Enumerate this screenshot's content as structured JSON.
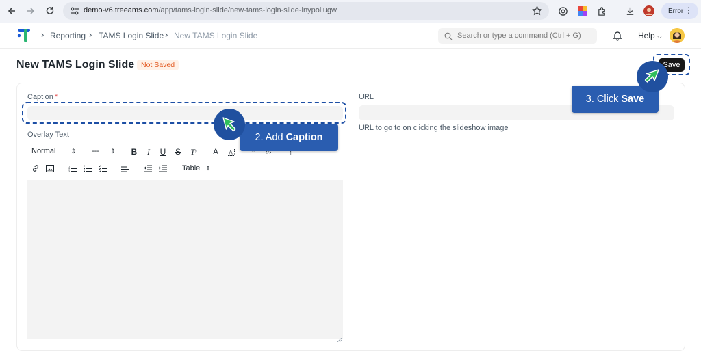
{
  "browser": {
    "url_host": "demo-v6.treeams.com",
    "url_path": "/app/tams-login-slide/new-tams-login-slide-lnypoiiugw",
    "profile_label": "Error"
  },
  "navbar": {
    "breadcrumbs": [
      "Reporting",
      "TAMS Login Slide",
      "New TAMS Login Slide"
    ],
    "search_placeholder": "Search or type a command (Ctrl + G)",
    "help_label": "Help"
  },
  "page": {
    "title": "New TAMS Login Slide",
    "status": "Not Saved",
    "save_label": "Save"
  },
  "form": {
    "caption_label": "Caption",
    "caption_required_mark": "*",
    "caption_value": "",
    "overlay_label": "Overlay Text",
    "url_label": "URL",
    "url_value": "",
    "url_help": "URL to go to on clicking the slideshow image"
  },
  "editor_toolbar": {
    "header_select": "Normal",
    "size_select": "---",
    "table_select": "Table"
  },
  "tutorial": {
    "step2_prefix": "2. Add",
    "step2_bold": "Caption",
    "step3_prefix": "3. Click",
    "step3_bold": "Save"
  },
  "colors": {
    "callout_bg": "#2a5db0",
    "highlight_border": "#1d4fa5",
    "pointer_arrow": "#2fbf5b",
    "status_text": "#e2561c",
    "status_bg": "#fff1e7",
    "logo_blue": "#1a5bd8",
    "logo_green": "#2bb673"
  },
  "icons": [
    "back-arrow-icon",
    "forward-arrow-icon",
    "reload-icon",
    "site-settings-icon",
    "star-icon",
    "extensions-icon",
    "download-icon",
    "search-icon",
    "bell-icon",
    "chevron-down-icon",
    "link-icon",
    "image-icon"
  ]
}
